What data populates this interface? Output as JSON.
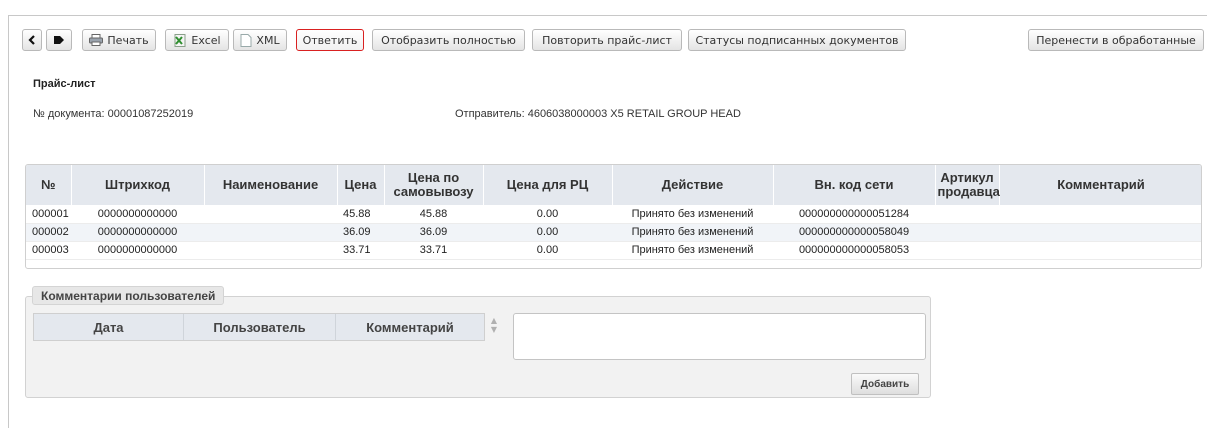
{
  "toolbar": {
    "print_label": "Печать",
    "excel_label": "Excel",
    "xml_label": "XML",
    "reply_label": "Ответить",
    "show_full_label": "Отобразить полностью",
    "repeat_price_label": "Повторить прайс-лист",
    "signed_status_label": "Статусы подписанных документов",
    "move_processed_label": "Перенести в обработанные"
  },
  "document": {
    "title": "Прайс-лист",
    "number": "№ документа: 00001087252019",
    "sender": "Отправитель: 4606038000003 X5 RETAIL GROUP HEAD"
  },
  "grid": {
    "columns": [
      "№",
      "Штрихкод",
      "Наименование",
      "Цена",
      "Цена по самовывозу",
      "Цена для РЦ",
      "Действие",
      "Вн. код сети",
      "Артикул продавца",
      "Комментарий"
    ],
    "rows": [
      [
        "000001",
        "0000000000000",
        "",
        "45.88",
        "45.88",
        "0.00",
        "Принято без изменений",
        "000000000000051284",
        "",
        ""
      ],
      [
        "000002",
        "0000000000000",
        "",
        "36.09",
        "36.09",
        "0.00",
        "Принято без изменений",
        "000000000000058049",
        "",
        ""
      ],
      [
        "000003",
        "0000000000000",
        "",
        "33.71",
        "33.71",
        "0.00",
        "Принято без изменений",
        "000000000000058053",
        "",
        ""
      ]
    ]
  },
  "comments": {
    "legend": "Комментарии пользователей",
    "columns": [
      "Дата",
      "Пользователь",
      "Комментарий"
    ],
    "text_value": "",
    "add_label": "Добавить"
  },
  "icons": {
    "back": "chevron-left-icon",
    "tag": "tag-icon",
    "print": "printer-icon",
    "excel": "excel-icon",
    "xml": "document-icon"
  },
  "colors": {
    "active_border": "#d92121",
    "header_bg": "#e4e8ee",
    "alt_row": "#f1f4f8"
  }
}
